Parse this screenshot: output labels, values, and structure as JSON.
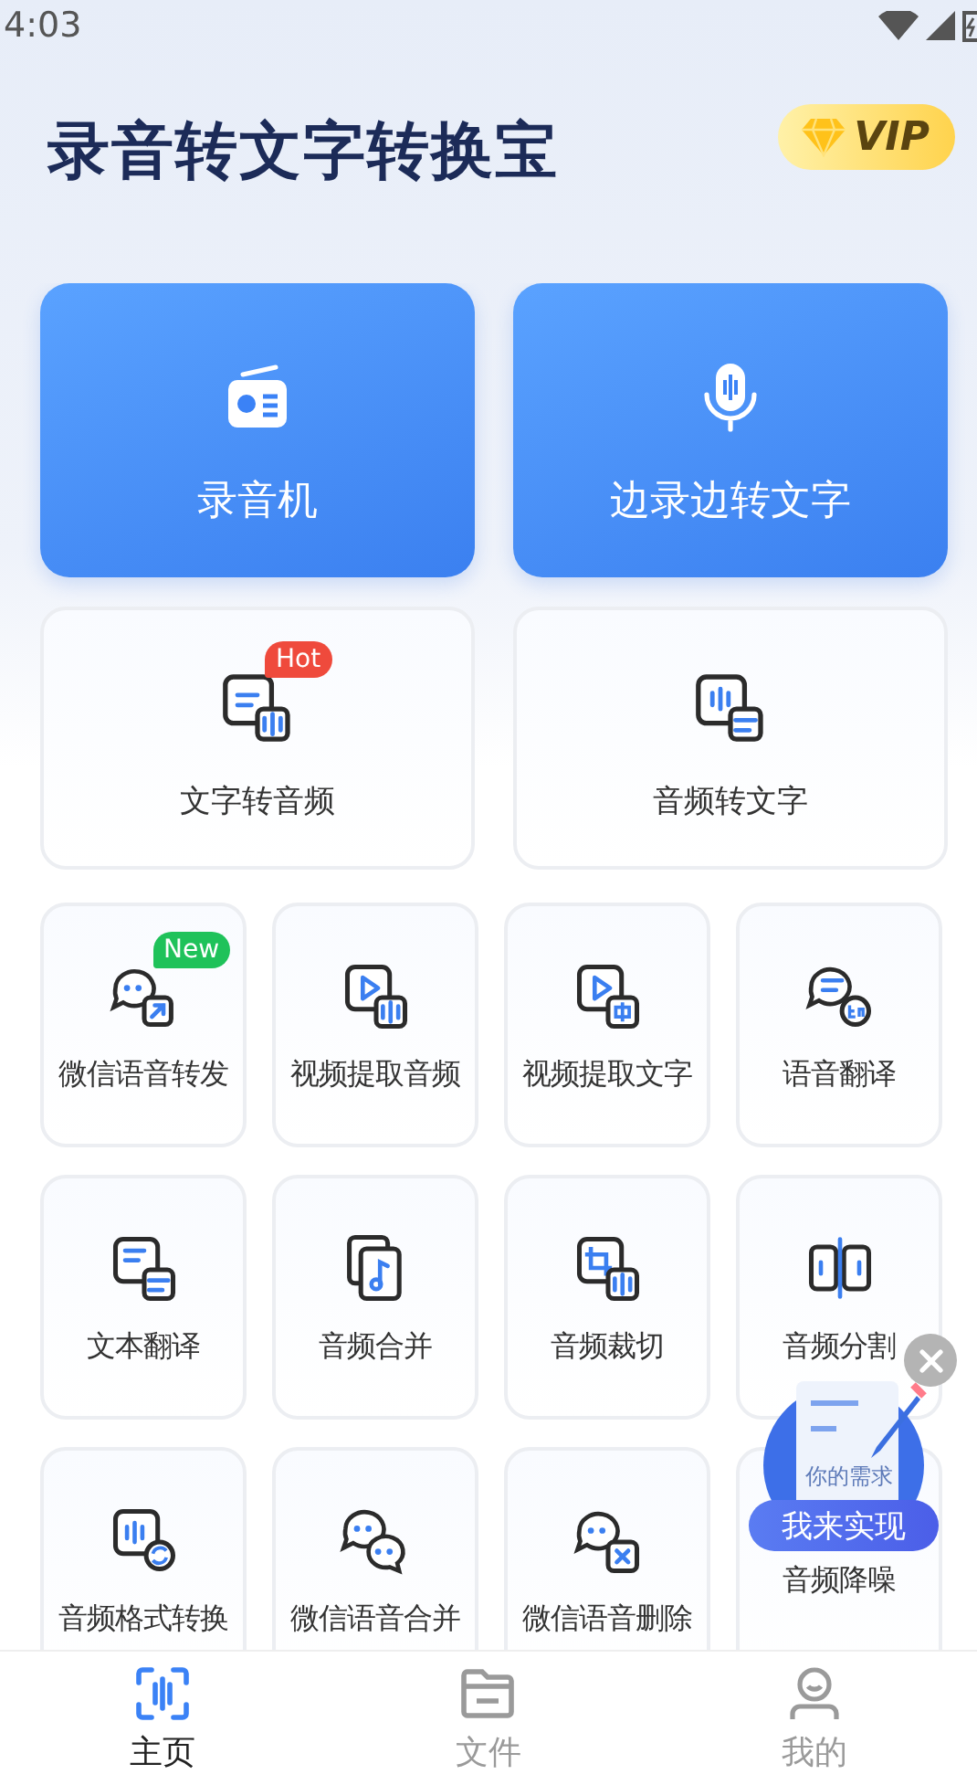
{
  "status_bar": {
    "time": "4:03"
  },
  "header": {
    "title": "录音转文字转换宝",
    "vip": "VIP"
  },
  "primary_actions": [
    {
      "label": "录音机"
    },
    {
      "label": "边录边转文字"
    }
  ],
  "featured_tools": [
    {
      "label": "文字转音频",
      "badge": {
        "label": "Hot",
        "color": "#ef4a3c"
      }
    },
    {
      "label": "音频转文字"
    }
  ],
  "tools": [
    {
      "label": "微信语音转发",
      "badge": {
        "label": "New",
        "color": "#1fc25a"
      }
    },
    {
      "label": "视频提取音频"
    },
    {
      "label": "视频提取文字"
    },
    {
      "label": "语音翻译"
    },
    {
      "label": "文本翻译"
    },
    {
      "label": "音频合并"
    },
    {
      "label": "音频裁切"
    },
    {
      "label": "音频分割"
    },
    {
      "label": "音频格式转换"
    },
    {
      "label": "微信语音合并"
    },
    {
      "label": "微信语音删除"
    },
    {
      "label": "音频降噪"
    }
  ],
  "promo": {
    "caption": "你的需求",
    "button": "我来实现"
  },
  "bottom_nav": [
    {
      "label": "主页",
      "selected": true
    },
    {
      "label": "文件",
      "selected": false
    },
    {
      "label": "我的",
      "selected": false
    }
  ]
}
